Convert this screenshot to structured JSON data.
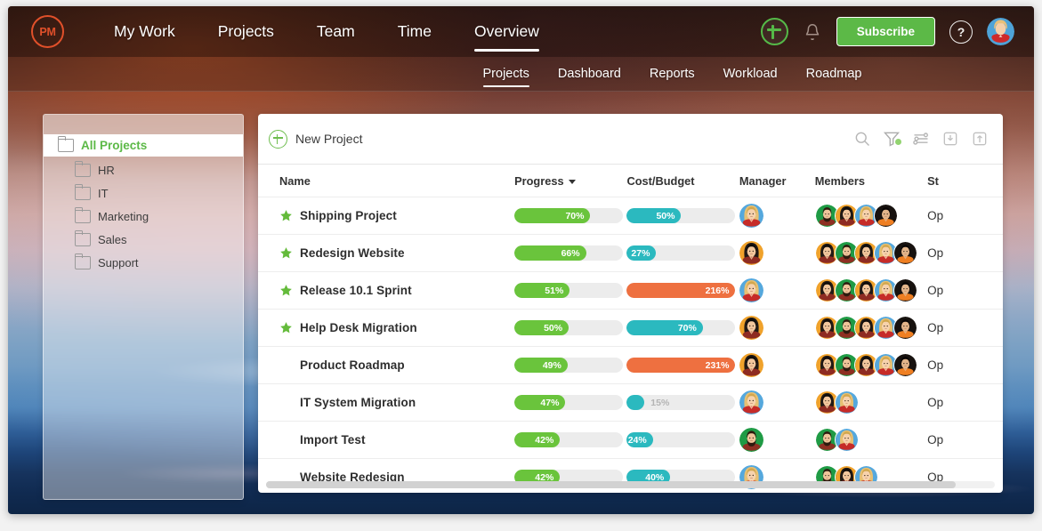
{
  "app": {
    "logo_text": "PM",
    "brand_color": "#e0502a",
    "accent_green": "#5cb947",
    "bar_green": "#6ac43c",
    "bar_teal": "#2bb9bf",
    "bar_orange": "#ee7040",
    "track_gray": "#ececec"
  },
  "topnav": {
    "items": [
      {
        "label": "My Work",
        "active": false
      },
      {
        "label": "Projects",
        "active": false
      },
      {
        "label": "Team",
        "active": false
      },
      {
        "label": "Time",
        "active": false
      },
      {
        "label": "Overview",
        "active": true
      }
    ],
    "add_icon": "plus-circle-icon",
    "bell_icon": "bell-icon",
    "subscribe_label": "Subscribe",
    "help_icon": "question-mark-icon",
    "avatar": "user-avatar"
  },
  "subnav": {
    "items": [
      {
        "label": "Projects",
        "active": true
      },
      {
        "label": "Dashboard",
        "active": false
      },
      {
        "label": "Reports",
        "active": false
      },
      {
        "label": "Workload",
        "active": false
      },
      {
        "label": "Roadmap",
        "active": false
      }
    ]
  },
  "sidebar": {
    "root": {
      "label": "All Projects",
      "icon": "folder-icon"
    },
    "items": [
      {
        "label": "HR",
        "icon": "folder-icon"
      },
      {
        "label": "IT",
        "icon": "folder-icon"
      },
      {
        "label": "Marketing",
        "icon": "folder-icon"
      },
      {
        "label": "Sales",
        "icon": "folder-icon"
      },
      {
        "label": "Support",
        "icon": "folder-icon"
      }
    ]
  },
  "toolbar": {
    "new_project_label": "New Project",
    "icons": [
      {
        "name": "search-icon",
        "badge": false
      },
      {
        "name": "filter-icon",
        "badge": true
      },
      {
        "name": "settings-sliders-icon",
        "badge": false
      },
      {
        "name": "import-icon",
        "badge": false
      },
      {
        "name": "export-icon",
        "badge": false
      }
    ]
  },
  "table": {
    "columns": [
      {
        "key": "name",
        "label": "Name",
        "sorted": false
      },
      {
        "key": "prog",
        "label": "Progress",
        "sorted": true
      },
      {
        "key": "cost",
        "label": "Cost/Budget",
        "sorted": false
      },
      {
        "key": "mgr",
        "label": "Manager",
        "sorted": false
      },
      {
        "key": "mem",
        "label": "Members",
        "sorted": false
      },
      {
        "key": "status",
        "label": "St",
        "sorted": false
      }
    ],
    "rows": [
      {
        "starred": true,
        "name": "Shipping Project",
        "progress": 70,
        "cost": 50,
        "cost_state": "normal",
        "manager": "f-blonde",
        "members": [
          "m-green",
          "f-dark",
          "f-blonde",
          "m-black"
        ],
        "status": "Op"
      },
      {
        "starred": true,
        "name": "Redesign Website",
        "progress": 66,
        "cost": 27,
        "cost_state": "normal",
        "manager": "f-dark",
        "members": [
          "f-orange",
          "m-green",
          "f-dark",
          "f-blonde",
          "m-black"
        ],
        "status": "Op"
      },
      {
        "starred": true,
        "name": "Release 10.1 Sprint",
        "progress": 51,
        "cost": 216,
        "cost_state": "over",
        "manager": "f-blonde",
        "members": [
          "f-orange",
          "m-green",
          "f-dark",
          "f-blonde",
          "m-black"
        ],
        "status": "Op"
      },
      {
        "starred": true,
        "name": "Help Desk Migration",
        "progress": 50,
        "cost": 70,
        "cost_state": "normal",
        "manager": "f-dark",
        "members": [
          "f-orange",
          "m-green",
          "f-dark",
          "f-blonde",
          "m-black"
        ],
        "status": "Op"
      },
      {
        "starred": false,
        "name": "Product Roadmap",
        "progress": 49,
        "cost": 231,
        "cost_state": "over",
        "manager": "f-dark",
        "members": [
          "f-orange",
          "m-green",
          "f-dark",
          "f-blonde",
          "m-black"
        ],
        "status": "Op"
      },
      {
        "starred": false,
        "name": "IT System Migration",
        "progress": 47,
        "cost": 15,
        "cost_state": "small",
        "manager": "f-blonde",
        "members": [
          "f-dark",
          "f-blonde"
        ],
        "status": "Op"
      },
      {
        "starred": false,
        "name": "Import Test",
        "progress": 42,
        "cost": 24,
        "cost_state": "normal",
        "manager": "m-green",
        "members": [
          "m-green",
          "f-blonde"
        ],
        "status": "Op"
      },
      {
        "starred": false,
        "name": "Website Redesign",
        "progress": 42,
        "cost": 40,
        "cost_state": "normal",
        "manager": "f-blonde",
        "members": [
          "m-green",
          "f-dark",
          "f-blonde"
        ],
        "status": "Op"
      }
    ],
    "star_icon": "star-icon"
  },
  "scrollbar": {
    "name": "horizontal-scrollbar",
    "thumb_fraction": 0.94
  }
}
